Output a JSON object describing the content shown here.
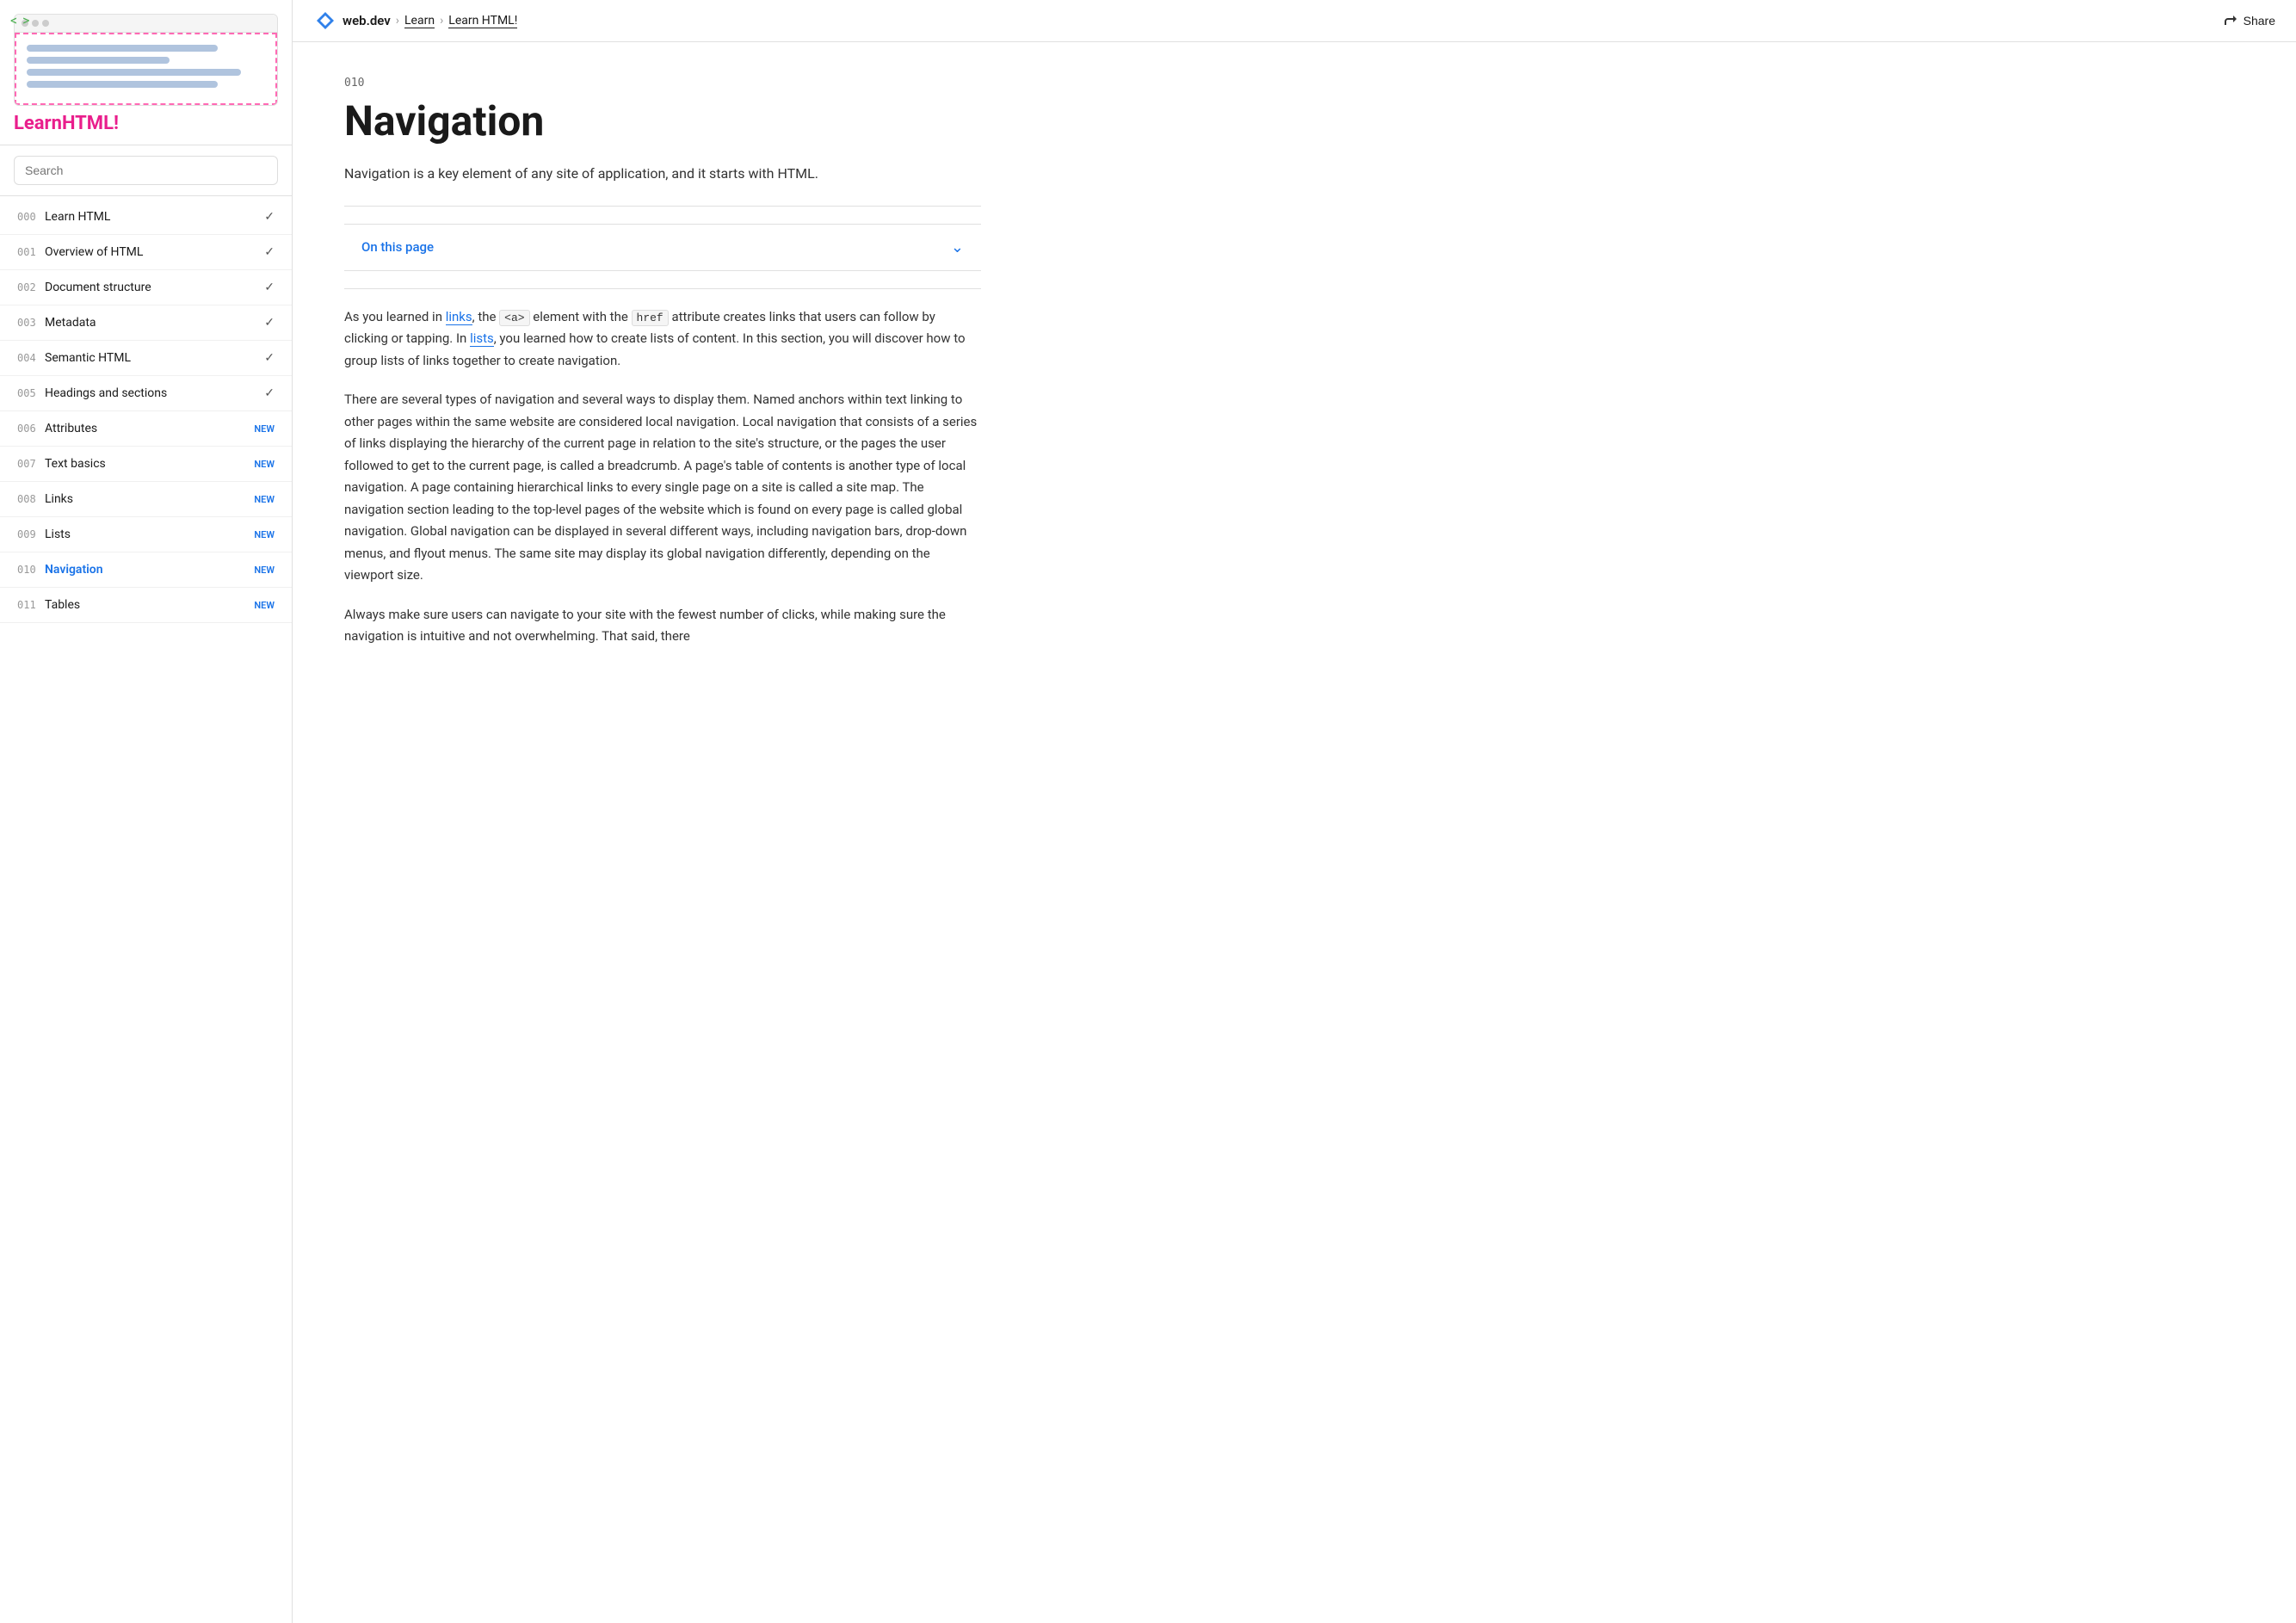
{
  "sidebar": {
    "logo": "LearnHTML!",
    "logo_plain": "Learn",
    "logo_colored": "HTML!",
    "search_placeholder": "Search",
    "items": [
      {
        "number": "000",
        "label": "Learn HTML",
        "badge": "check",
        "active": false
      },
      {
        "number": "001",
        "label": "Overview of HTML",
        "badge": "check",
        "active": false
      },
      {
        "number": "002",
        "label": "Document structure",
        "badge": "check",
        "active": false
      },
      {
        "number": "003",
        "label": "Metadata",
        "badge": "check",
        "active": false
      },
      {
        "number": "004",
        "label": "Semantic HTML",
        "badge": "check",
        "active": false
      },
      {
        "number": "005",
        "label": "Headings and sections",
        "badge": "check",
        "active": false
      },
      {
        "number": "006",
        "label": "Attributes",
        "badge": "NEW",
        "active": false
      },
      {
        "number": "007",
        "label": "Text basics",
        "badge": "NEW",
        "active": false
      },
      {
        "number": "008",
        "label": "Links",
        "badge": "NEW",
        "active": false
      },
      {
        "number": "009",
        "label": "Lists",
        "badge": "NEW",
        "active": false
      },
      {
        "number": "010",
        "label": "Navigation",
        "badge": "NEW",
        "active": true
      },
      {
        "number": "011",
        "label": "Tables",
        "badge": "NEW",
        "active": false
      }
    ]
  },
  "breadcrumb": {
    "site": "web.dev",
    "section": "Learn",
    "page": "Learn HTML!"
  },
  "share_label": "Share",
  "content": {
    "section_number": "010",
    "title": "Navigation",
    "subtitle": "Navigation is a key element of any site of application, and it starts with HTML.",
    "on_this_page": "On this page",
    "paragraphs": [
      "As you learned in links, the <a> element with the href attribute creates links that users can follow by clicking or tapping. In lists, you learned how to create lists of content. In this section, you will discover how to group lists of links together to create navigation.",
      "There are several types of navigation and several ways to display them. Named anchors within text linking to other pages within the same website are considered local navigation. Local navigation that consists of a series of links displaying the hierarchy of the current page in relation to the site's structure, or the pages the user followed to get to the current page, is called a breadcrumb. A page's table of contents is another type of local navigation. A page containing hierarchical links to every single page on a site is called a site map. The navigation section leading to the top-level pages of the website which is found on every page is called global navigation. Global navigation can be displayed in several different ways, including navigation bars, drop-down menus, and flyout menus. The same site may display its global navigation differently, depending on the viewport size.",
      "Always make sure users can navigate to your site with the fewest number of clicks, while making sure the navigation is intuitive and not overwhelming. That said, there"
    ]
  },
  "icons": {
    "share": "⬆",
    "chevron_left": "<",
    "chevron_right": ">",
    "chevron_down": "⌄",
    "check": "✓"
  }
}
